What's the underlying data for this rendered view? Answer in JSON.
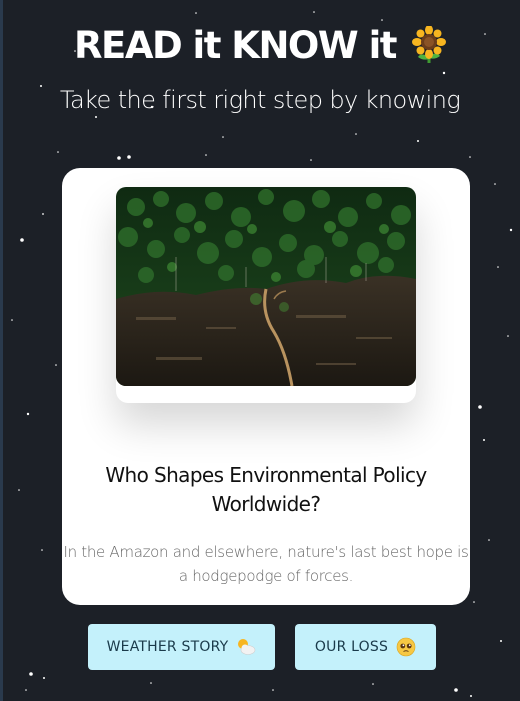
{
  "header": {
    "title": "READ it KNOW it",
    "title_icon": "sunflower-icon",
    "tagline": "Take the first right step by knowing"
  },
  "article": {
    "image": "aerial-deforestation-photo",
    "headline": "Who Shapes Environmental Policy Worldwide?",
    "summary": "In the Amazon and elsewhere, nature's last best hope is a hodgepodge of forces."
  },
  "buttons": [
    {
      "label": "WEATHER STORY",
      "icon": "sun-behind-cloud-icon"
    },
    {
      "label": "OUR LOSS",
      "icon": "pleading-face-icon"
    }
  ],
  "colors": {
    "background": "#1c2027",
    "card": "#ffffff",
    "button": "#c4f1fb",
    "button_text": "#1a3a4a"
  }
}
